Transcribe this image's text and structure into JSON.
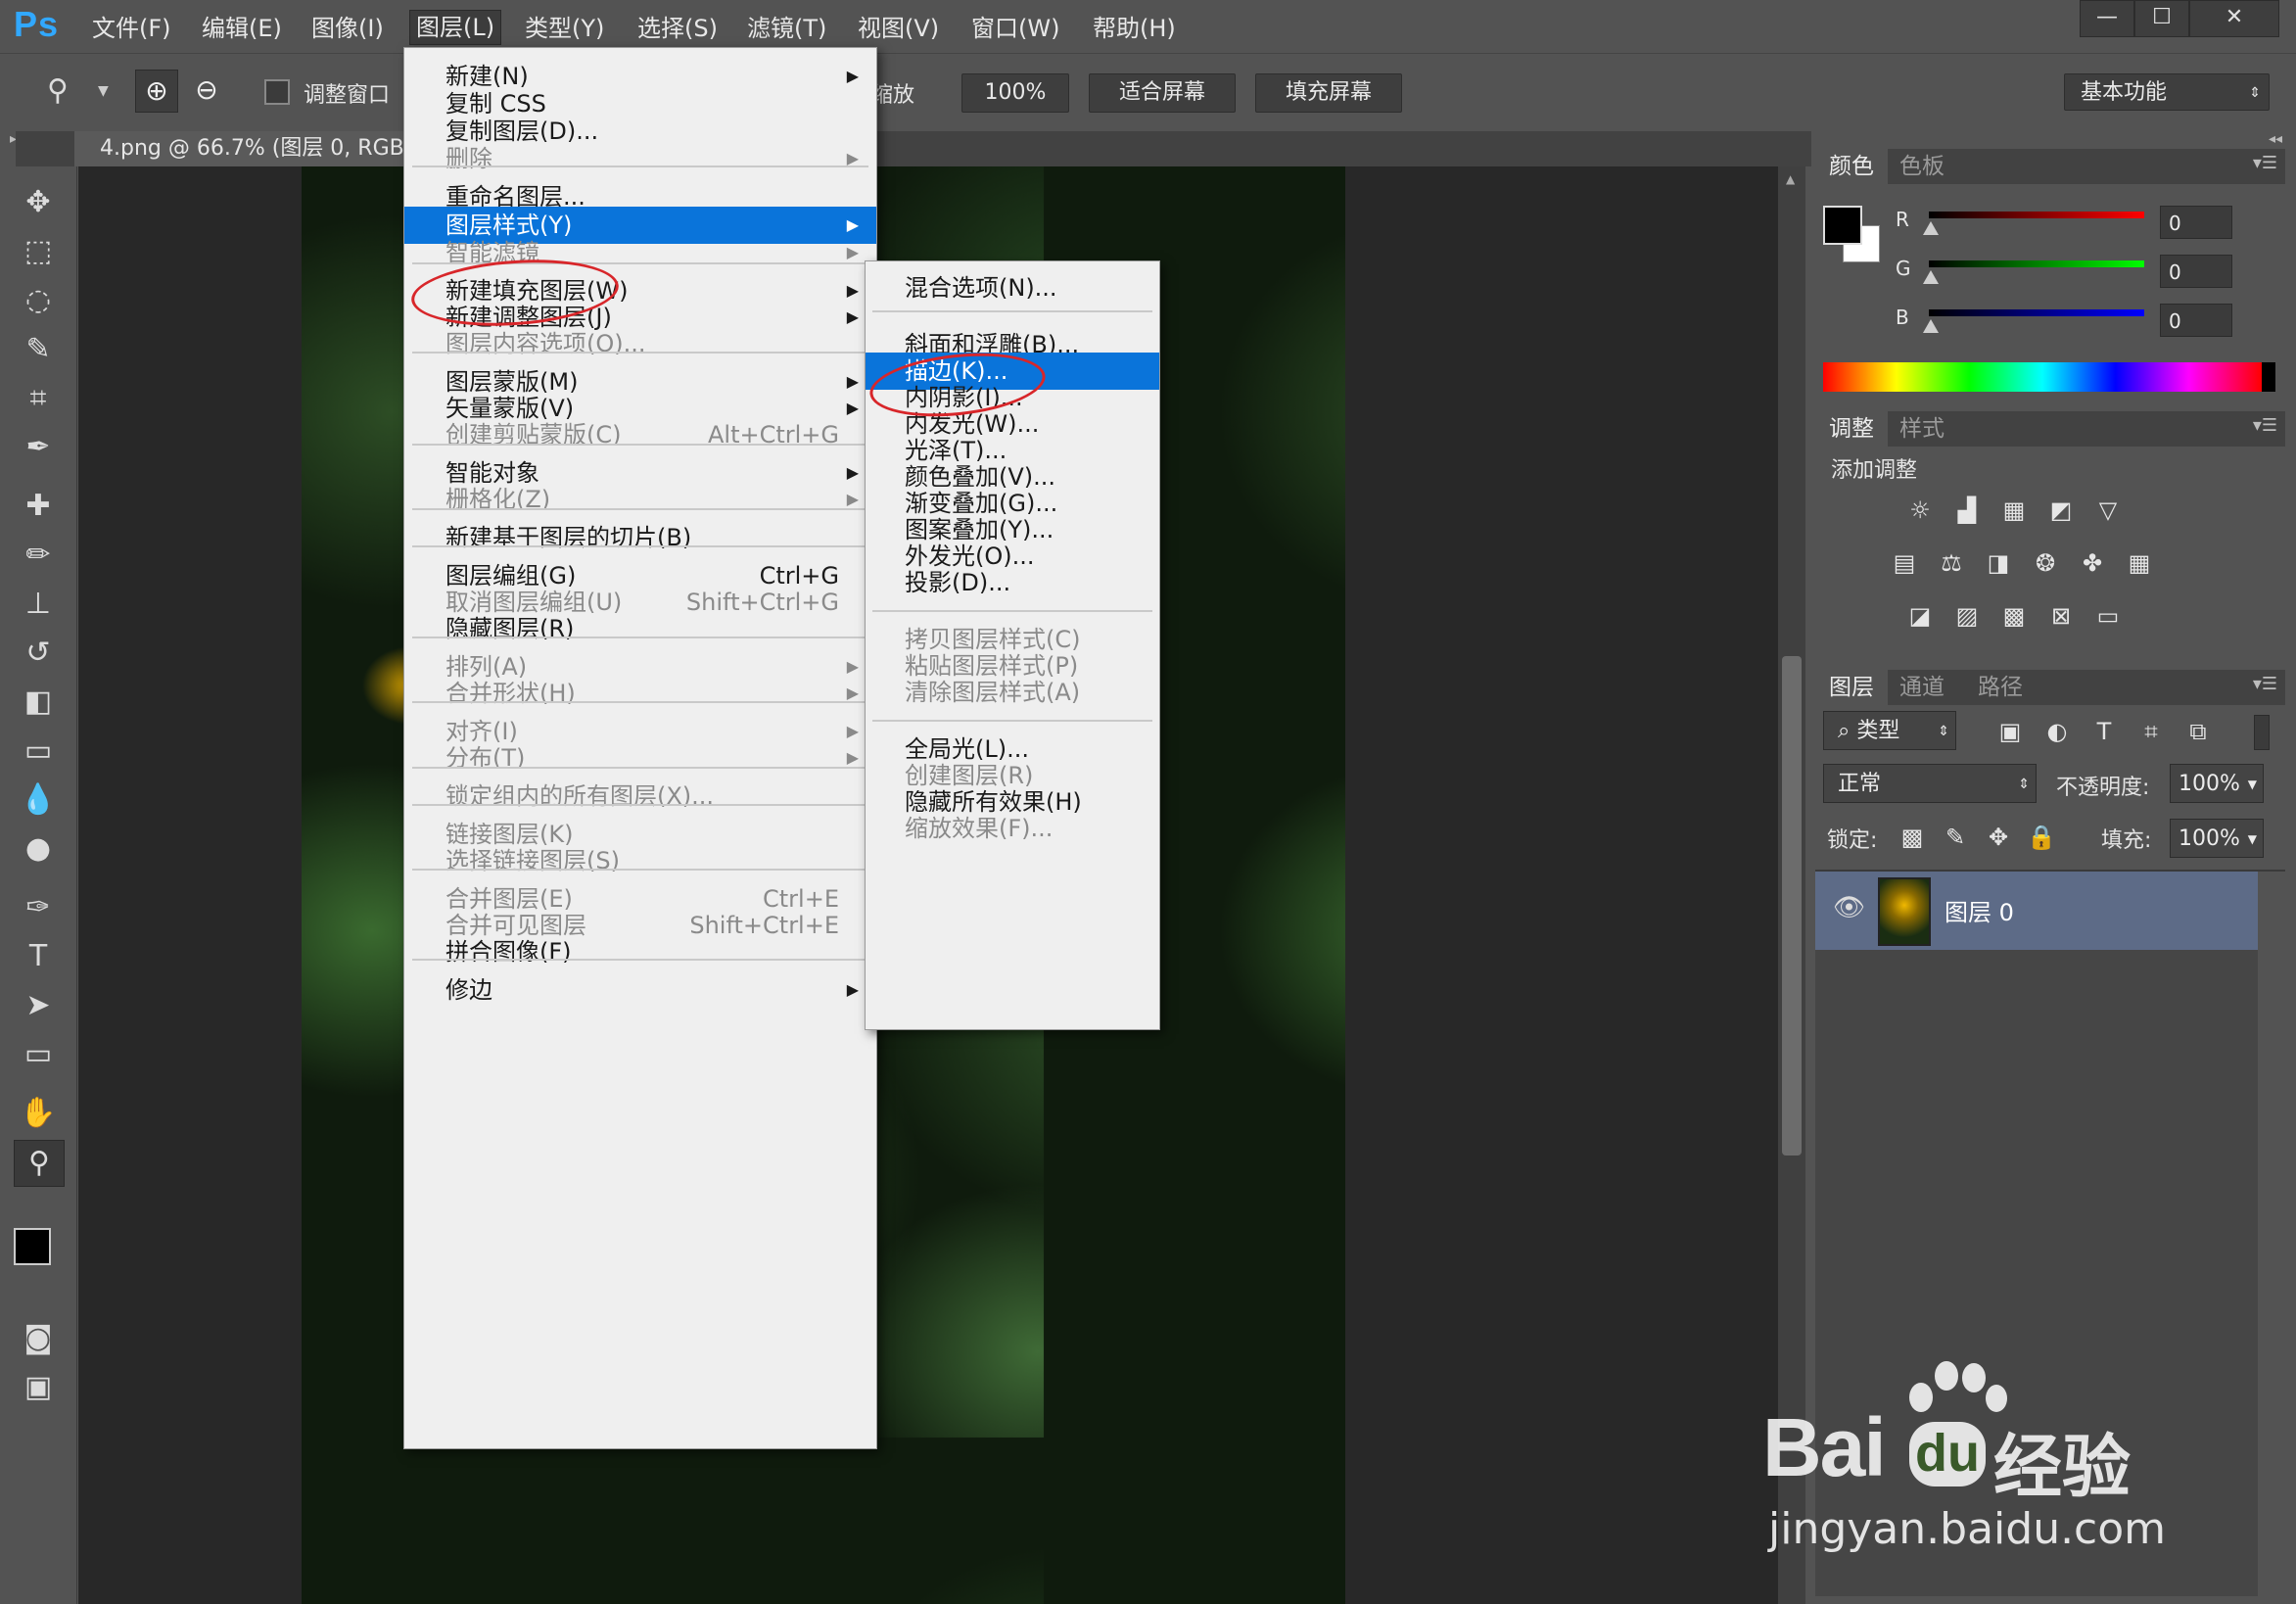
{
  "app": {
    "logo": "Ps"
  },
  "menubar": {
    "items": [
      "文件(F)",
      "编辑(E)",
      "图像(I)",
      "图层(L)",
      "类型(Y)",
      "选择(S)",
      "滤镜(T)",
      "视图(V)",
      "窗口(W)",
      "帮助(H)"
    ],
    "active_index": 3
  },
  "window_controls": {
    "minimize": "—",
    "maximize": "☐",
    "close": "✕"
  },
  "options_bar": {
    "resize_windows_label": "调整窗口",
    "scrubby_zoom_label": "缩放",
    "zoom_btn": "100%",
    "fit_screen_btn": "适合屏幕",
    "fill_screen_btn": "填充屏幕",
    "workspace": "基本功能"
  },
  "document": {
    "tab_title": "4.png @ 66.7% (图层 0, RGB"
  },
  "layer_menu": {
    "items": [
      {
        "label": "新建(N)",
        "arrow": true
      },
      {
        "label": "复制 CSS"
      },
      {
        "label": "复制图层(D)..."
      },
      {
        "label": "删除",
        "disabled": true,
        "arrow": true
      },
      {
        "label": "重命名图层..."
      },
      {
        "label": "图层样式(Y)",
        "highlighted": true,
        "arrow": true
      },
      {
        "label": "智能滤镜",
        "disabled": true,
        "arrow": true
      },
      {
        "label": "新建填充图层(W)",
        "arrow": true
      },
      {
        "label": "新建调整图层(J)",
        "arrow": true
      },
      {
        "label": "图层内容选项(O)...",
        "disabled": true
      },
      {
        "label": "图层蒙版(M)",
        "arrow": true
      },
      {
        "label": "矢量蒙版(V)",
        "arrow": true
      },
      {
        "label": "创建剪贴蒙版(C)",
        "disabled": true,
        "shortcut": "Alt+Ctrl+G"
      },
      {
        "label": "智能对象",
        "arrow": true
      },
      {
        "label": "栅格化(Z)",
        "disabled": true,
        "arrow": true
      },
      {
        "label": "新建基于图层的切片(B)"
      },
      {
        "label": "图层编组(G)",
        "shortcut": "Ctrl+G"
      },
      {
        "label": "取消图层编组(U)",
        "disabled": true,
        "shortcut": "Shift+Ctrl+G"
      },
      {
        "label": "隐藏图层(R)"
      },
      {
        "label": "排列(A)",
        "disabled": true,
        "arrow": true
      },
      {
        "label": "合并形状(H)",
        "disabled": true,
        "arrow": true
      },
      {
        "label": "对齐(I)",
        "disabled": true,
        "arrow": true
      },
      {
        "label": "分布(T)",
        "disabled": true,
        "arrow": true
      },
      {
        "label": "锁定组内的所有图层(X)...",
        "disabled": true
      },
      {
        "label": "链接图层(K)",
        "disabled": true
      },
      {
        "label": "选择链接图层(S)",
        "disabled": true
      },
      {
        "label": "合并图层(E)",
        "disabled": true,
        "shortcut": "Ctrl+E"
      },
      {
        "label": "合并可见图层",
        "disabled": true,
        "shortcut": "Shift+Ctrl+E"
      },
      {
        "label": "拼合图像(F)"
      },
      {
        "label": "修边",
        "arrow": true
      }
    ]
  },
  "style_submenu": {
    "items": [
      {
        "label": "混合选项(N)..."
      },
      {
        "label": "斜面和浮雕(B)..."
      },
      {
        "label": "描边(K)...",
        "highlighted": true
      },
      {
        "label": "内阴影(I)..."
      },
      {
        "label": "内发光(W)..."
      },
      {
        "label": "光泽(T)..."
      },
      {
        "label": "颜色叠加(V)..."
      },
      {
        "label": "渐变叠加(G)..."
      },
      {
        "label": "图案叠加(Y)..."
      },
      {
        "label": "外发光(O)..."
      },
      {
        "label": "投影(D)..."
      },
      {
        "label": "拷贝图层样式(C)",
        "disabled": true
      },
      {
        "label": "粘贴图层样式(P)",
        "disabled": true
      },
      {
        "label": "清除图层样式(A)",
        "disabled": true
      },
      {
        "label": "全局光(L)..."
      },
      {
        "label": "创建图层(R)",
        "disabled": true
      },
      {
        "label": "隐藏所有效果(H)"
      },
      {
        "label": "缩放效果(F)...",
        "disabled": true
      }
    ]
  },
  "color_panel": {
    "tabs": [
      "颜色",
      "色板"
    ],
    "channels": [
      {
        "name": "R",
        "value": "0"
      },
      {
        "name": "G",
        "value": "0"
      },
      {
        "name": "B",
        "value": "0"
      }
    ]
  },
  "adjust_panel": {
    "tabs": [
      "调整",
      "样式"
    ],
    "add_label": "添加调整"
  },
  "layers_panel": {
    "tabs": [
      "图层",
      "通道",
      "路径"
    ],
    "filter_kind": "类型",
    "blend_mode": "正常",
    "opacity_label": "不透明度:",
    "opacity": "100%",
    "lock_label": "锁定:",
    "fill_label": "填充:",
    "fill": "100%",
    "layer_name": "图层 0"
  },
  "watermark": {
    "brand": "Bai",
    "brand_cn": "经验",
    "url": "jingyan.baidu.com"
  },
  "colors": {
    "highlight": "#0a74da",
    "annotation": "#d8262a",
    "ps_blue": "#31a8ff"
  }
}
